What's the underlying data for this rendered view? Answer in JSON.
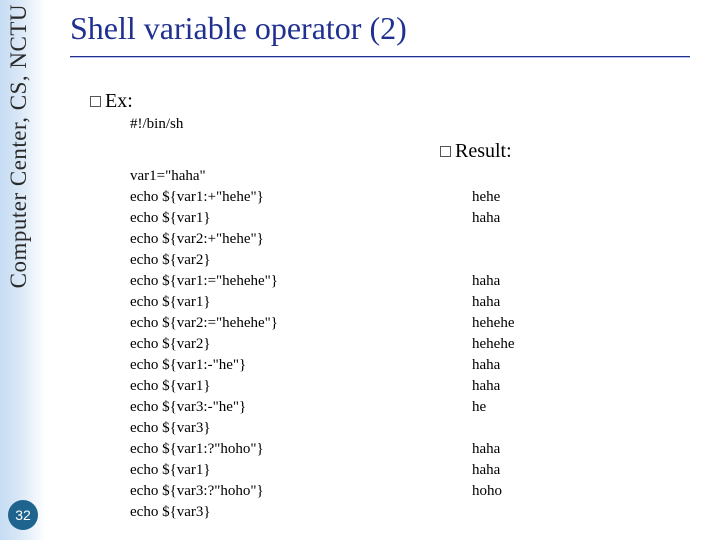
{
  "sidebar_text": "Computer Center, CS, NCTU",
  "page_number": "32",
  "title": "Shell variable operator (2)",
  "labels": {
    "ex": "Ex:",
    "result": "Result:"
  },
  "shebang": "#!/bin/sh",
  "code_lines": [
    "var1=\"haha\"",
    "echo ${var1:+\"hehe\"}",
    "echo ${var1}",
    "echo ${var2:+\"hehe\"}",
    "echo ${var2}",
    "echo ${var1:=\"hehehe\"}",
    "echo ${var1}",
    "echo ${var2:=\"hehehe\"}",
    "echo ${var2}",
    "echo ${var1:-\"he\"}",
    "echo ${var1}",
    "echo ${var3:-\"he\"}",
    "echo ${var3}",
    "echo ${var1:?\"hoho\"}",
    "echo ${var1}",
    "echo ${var3:?\"hoho\"}",
    "echo ${var3}"
  ],
  "output_lines": [
    "",
    "hehe",
    "haha",
    "",
    "",
    "haha",
    "haha",
    "hehehe",
    "hehehe",
    "haha",
    "haha",
    "he",
    "",
    "haha",
    "haha",
    "hoho",
    ""
  ]
}
